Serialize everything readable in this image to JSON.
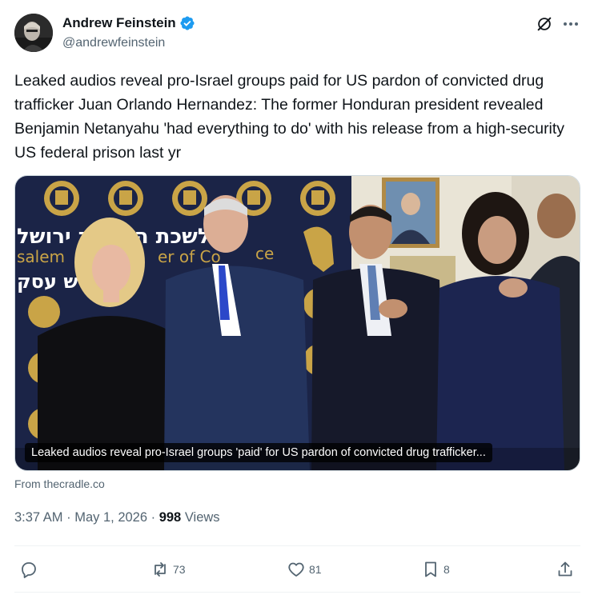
{
  "author": {
    "name": "Andrew Feinstein",
    "handle": "@andrewfeinstein",
    "verified": true,
    "badge_color": "#1d9bf0"
  },
  "tweet": {
    "text": "Leaked audios reveal pro-Israel groups paid for US pardon of convicted drug trafficker Juan Orlando Hernandez: The former Honduran president revealed Benjamin Netanyahu 'had everything to do' with his release from a high-security US federal prison last yr"
  },
  "media": {
    "caption": "Leaked audios reveal pro-Israel groups 'paid' for US pardon of convicted drug trafficker...",
    "backdrop_text_line1": "לשכת המסחר ירושל",
    "backdrop_text_line2": "salem",
    "backdrop_text_line3": "er of Co",
    "backdrop_text_line4": "ce",
    "backdrop_text_line5": "ש עסק"
  },
  "source": {
    "label": "From thecradle.co"
  },
  "meta": {
    "time": "3:37 AM",
    "separator1": " · ",
    "date": "May 1, 2026",
    "separator2": " · ",
    "views_count": "998",
    "views_label": " Views"
  },
  "actions": {
    "reply": {
      "icon": "reply-icon",
      "count": ""
    },
    "repost": {
      "icon": "repost-icon",
      "count": "73"
    },
    "like": {
      "icon": "heart-icon",
      "count": "81"
    },
    "bookmark": {
      "icon": "bookmark-icon",
      "count": "8"
    },
    "share": {
      "icon": "share-icon",
      "count": ""
    }
  },
  "colors": {
    "text_primary": "#0f1419",
    "text_secondary": "#536471",
    "accent": "#1d9bf0"
  }
}
